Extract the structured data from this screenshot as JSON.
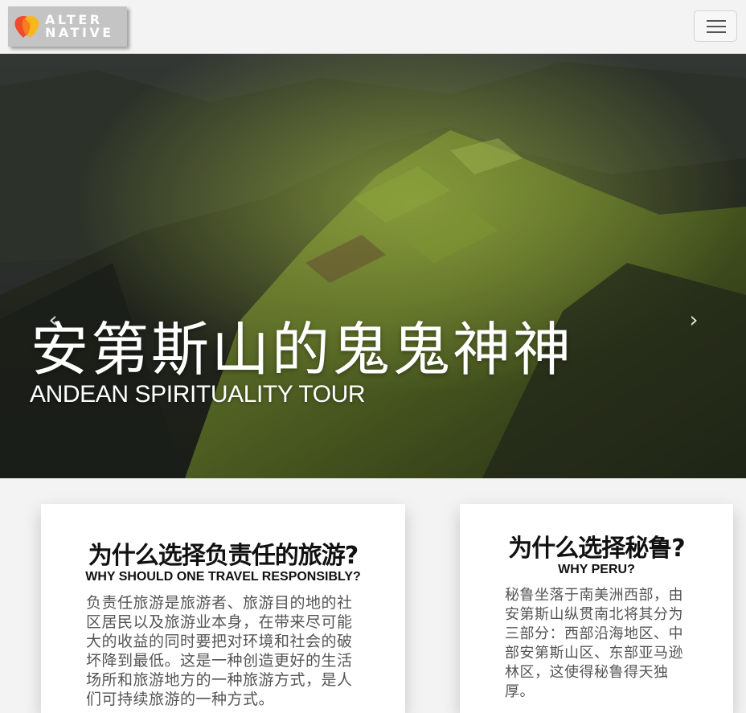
{
  "brand": {
    "line1": "ALTER",
    "line2": "NATIVE",
    "colors": {
      "logo_bg": "#c4c4c4",
      "mark_red": "#ef4a2b",
      "mark_yellow": "#f9b618"
    }
  },
  "nav": {
    "menu_icon": "hamburger-menu-icon"
  },
  "hero": {
    "title": "安第斯山的鬼鬼神神",
    "subtitle": "ANDEAN SPIRITUALITY TOUR",
    "prev_icon": "chevron-left-icon",
    "next_icon": "chevron-right-icon"
  },
  "cards": [
    {
      "title": "为什么选择负责任的旅游?",
      "subtitle": "WHY SHOULD ONE TRAVEL RESPONSIBLY?",
      "body": "负责任旅游是旅游者、旅游目的地的社区居民以及旅游业本身，在带来尽可能大的收益的同时要把对环境和社会的破坏降到最低。这是一种创造更好的生活场所和旅游地方的一种旅游方式，是人们可持续旅游的一种方式。"
    },
    {
      "title": "为什么选择秘鲁?",
      "subtitle": "WHY PERU?",
      "body": "秘鲁坐落于南美洲西部，由安第斯山纵贯南北将其分为三部分：西部沿海地区、中部安第斯山区、东部亚马逊林区，这使得秘鲁得天独厚。"
    }
  ]
}
